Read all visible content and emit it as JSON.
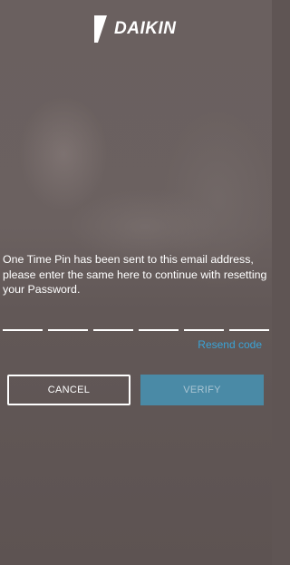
{
  "header": {
    "brand": "DAIKIN",
    "logo_icon": "daikin-logo-icon"
  },
  "message": "One Time Pin has been sent to this email address, please enter the same here to continue with resetting your Password.",
  "otp": {
    "length": 6,
    "values": [
      "",
      "",
      "",
      "",
      "",
      ""
    ]
  },
  "resend_label": "Resend code",
  "buttons": {
    "cancel_label": "CANCEL",
    "verify_label": "VERIFY"
  },
  "colors": {
    "accent": "#3aa3d6",
    "verify_bg": "#4a8aa6",
    "verify_text": "#a9c5d3"
  }
}
